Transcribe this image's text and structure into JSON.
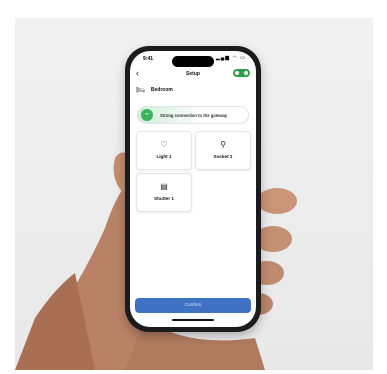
{
  "status_bar": {
    "time": "9:41",
    "icons": "▂▄▆ ◠ ▭"
  },
  "header": {
    "title": "Setup",
    "back_icon": "chevron-left-icon",
    "gateway_badge_icon": "gateway-icon"
  },
  "room": {
    "icon": "bed-icon",
    "label": "Bedroom"
  },
  "connection": {
    "icon": "wifi-icon",
    "text": "Strong connection to the gateway",
    "color": "#3bb35d"
  },
  "devices": [
    {
      "label": "Light 1",
      "icon": "lightbulb-icon"
    },
    {
      "label": "Socket 1",
      "icon": "plug-icon"
    },
    {
      "label": "Shutter 1",
      "icon": "shutter-icon"
    }
  ],
  "footer": {
    "confirm_label": "Confirm",
    "confirm_color": "#3f72c4"
  }
}
